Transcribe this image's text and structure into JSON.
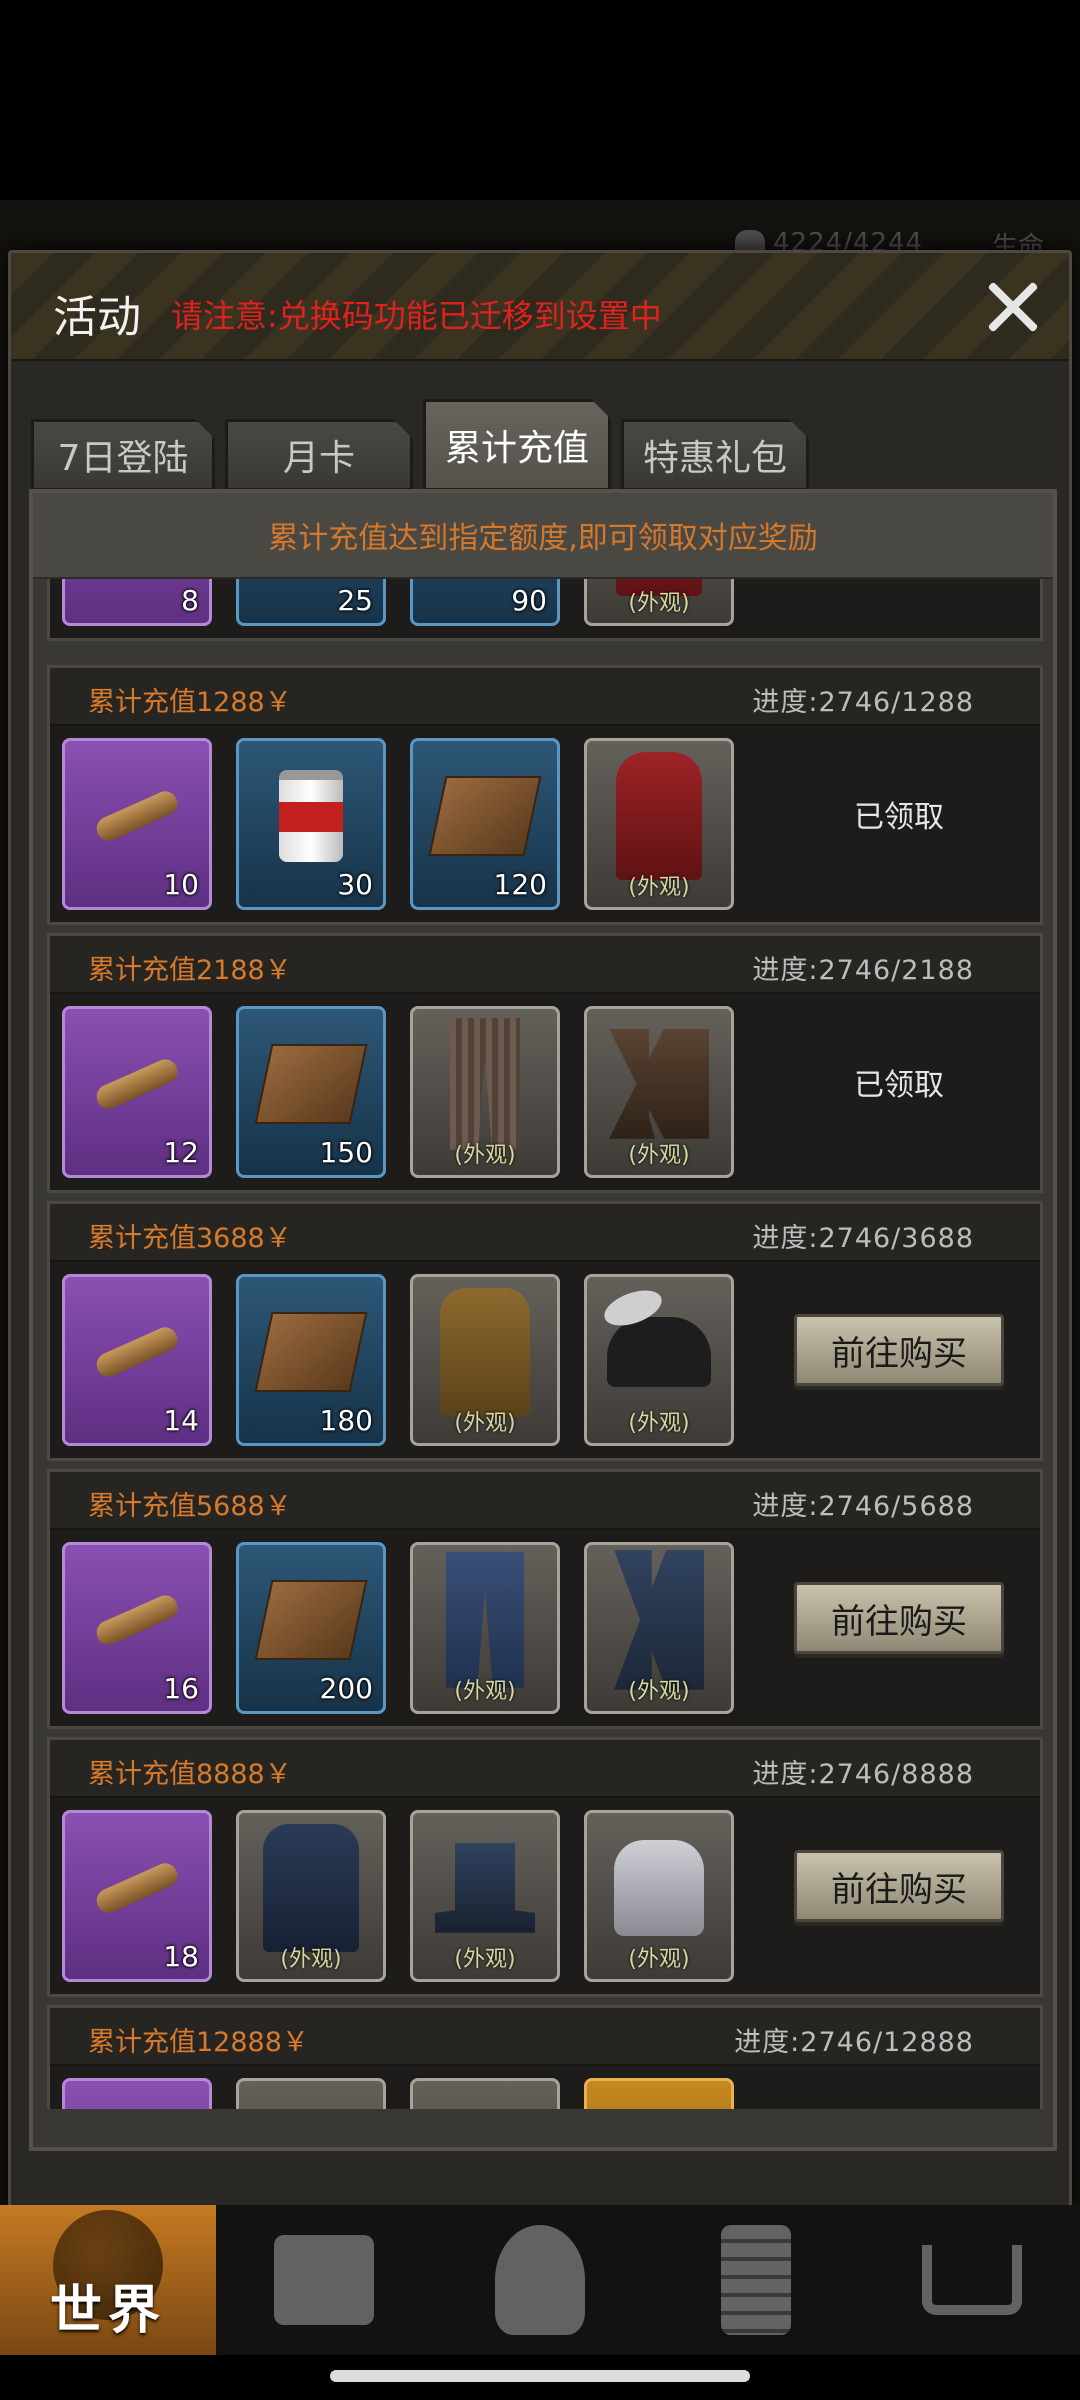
{
  "hud": {
    "hp": "4224/4244",
    "life_label": "生命"
  },
  "modal": {
    "title": "活动",
    "notice": "请注意:兑换码功能已迁移到设置中",
    "close_icon": "close-icon"
  },
  "tabs": [
    {
      "label": "7日登陆",
      "active": false
    },
    {
      "label": "月卡",
      "active": false
    },
    {
      "label": "累计充值",
      "active": true
    },
    {
      "label": "特惠礼包",
      "active": false
    }
  ],
  "hint": "累计充值达到指定额度,即可领取对应奖励",
  "rows": [
    {
      "title": "",
      "progress": "",
      "items": [
        {
          "rarity": "purple",
          "icon": "cigar-icon",
          "count": "8",
          "tag": ""
        },
        {
          "rarity": "blue",
          "icon": "meat-can-icon",
          "count": "25",
          "tag": ""
        },
        {
          "rarity": "blue",
          "icon": "wood-box-icon",
          "count": "90",
          "tag": ""
        },
        {
          "rarity": "gray",
          "icon": "outfit-icon",
          "count": "",
          "tag": "(外观)"
        }
      ],
      "action": ""
    },
    {
      "title": "累计充值1288￥",
      "progress": "进度:2746/1288",
      "items": [
        {
          "rarity": "purple",
          "icon": "cigar-icon",
          "count": "10",
          "tag": ""
        },
        {
          "rarity": "blue",
          "icon": "meat-can-icon",
          "count": "30",
          "tag": ""
        },
        {
          "rarity": "blue",
          "icon": "wood-box-icon",
          "count": "120",
          "tag": ""
        },
        {
          "rarity": "gray",
          "icon": "red-coat-icon",
          "count": "",
          "tag": "(外观)"
        }
      ],
      "action": "已领取",
      "state": "claimed"
    },
    {
      "title": "累计充值2188￥",
      "progress": "进度:2746/2188",
      "items": [
        {
          "rarity": "purple",
          "icon": "cigar-icon",
          "count": "12",
          "tag": ""
        },
        {
          "rarity": "blue",
          "icon": "wood-box-icon",
          "count": "150",
          "tag": ""
        },
        {
          "rarity": "gray",
          "icon": "striped-pants-icon",
          "count": "",
          "tag": "(外观)"
        },
        {
          "rarity": "gray",
          "icon": "boots-icon",
          "count": "",
          "tag": "(外观)"
        }
      ],
      "action": "已领取",
      "state": "claimed"
    },
    {
      "title": "累计充值3688￥",
      "progress": "进度:2746/3688",
      "items": [
        {
          "rarity": "purple",
          "icon": "cigar-icon",
          "count": "14",
          "tag": ""
        },
        {
          "rarity": "blue",
          "icon": "wood-box-icon",
          "count": "180",
          "tag": ""
        },
        {
          "rarity": "gray",
          "icon": "brown-jacket-icon",
          "count": "",
          "tag": "(外观)"
        },
        {
          "rarity": "gray",
          "icon": "feather-hat-icon",
          "count": "",
          "tag": "(外观)"
        }
      ],
      "action": "前往购买",
      "state": "buy"
    },
    {
      "title": "累计充值5688￥",
      "progress": "进度:2746/5688",
      "items": [
        {
          "rarity": "purple",
          "icon": "cigar-icon",
          "count": "16",
          "tag": ""
        },
        {
          "rarity": "blue",
          "icon": "wood-box-icon",
          "count": "200",
          "tag": ""
        },
        {
          "rarity": "gray",
          "icon": "jeans-icon",
          "count": "",
          "tag": "(外观)"
        },
        {
          "rarity": "gray",
          "icon": "tall-boots-icon",
          "count": "",
          "tag": "(外观)"
        }
      ],
      "action": "前往购买",
      "state": "buy"
    },
    {
      "title": "累计充值8888￥",
      "progress": "进度:2746/8888",
      "items": [
        {
          "rarity": "purple",
          "icon": "cigar-icon",
          "count": "18",
          "tag": ""
        },
        {
          "rarity": "gray",
          "icon": "vest-icon",
          "count": "",
          "tag": "(外观)"
        },
        {
          "rarity": "gray",
          "icon": "top-hat-icon",
          "count": "",
          "tag": "(外观)"
        },
        {
          "rarity": "gray",
          "icon": "crop-top-icon",
          "count": "",
          "tag": "(外观)"
        }
      ],
      "action": "前往购买",
      "state": "buy"
    },
    {
      "title": "累计充值12888￥",
      "progress": "进度:2746/12888",
      "items": [
        {
          "rarity": "purple",
          "icon": "cigar-icon",
          "count": "",
          "tag": ""
        },
        {
          "rarity": "gray",
          "icon": "dark-outfit-icon",
          "count": "",
          "tag": ""
        },
        {
          "rarity": "gray",
          "icon": "dark-outfit-icon",
          "count": "",
          "tag": ""
        },
        {
          "rarity": "orange",
          "icon": "gold-item-icon",
          "count": "",
          "tag": ""
        }
      ],
      "action": ""
    }
  ],
  "nav": [
    {
      "label": "世界",
      "icon": "globe-icon"
    },
    {
      "label": "",
      "icon": "backpack-icon"
    },
    {
      "label": "",
      "icon": "head-icon"
    },
    {
      "label": "",
      "icon": "phone-icon"
    },
    {
      "label": "",
      "icon": "cart-icon"
    }
  ]
}
